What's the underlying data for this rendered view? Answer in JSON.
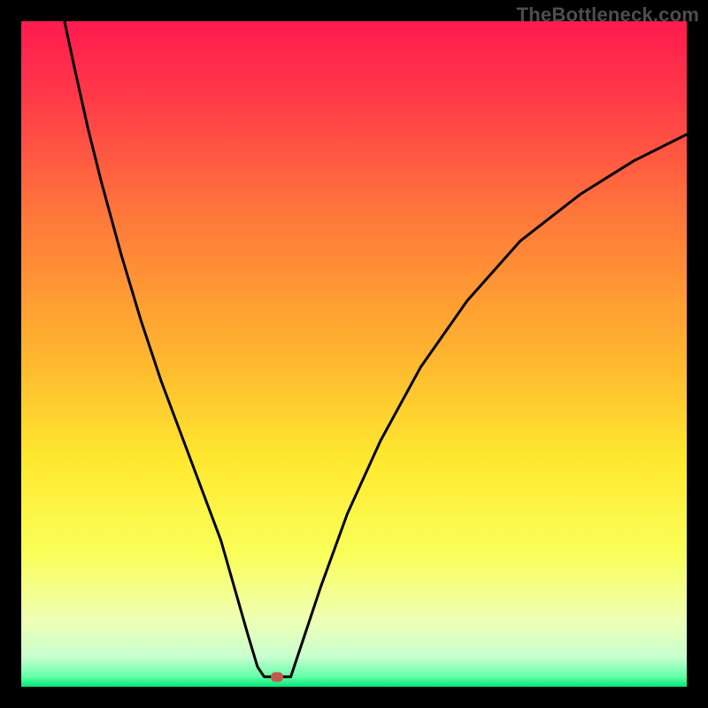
{
  "watermark": "TheBottleneck.com",
  "plot": {
    "inner_size": 752,
    "marker": {
      "x_frac": 0.384,
      "y_frac": 0.985,
      "color": "#c1594c"
    }
  },
  "chart_data": {
    "type": "line",
    "title": "",
    "xlabel": "",
    "ylabel": "",
    "xlim": [
      0,
      100
    ],
    "ylim": [
      0,
      100
    ],
    "gradient_stops": [
      {
        "offset": 0.0,
        "color": "#ff1a4f"
      },
      {
        "offset": 0.12,
        "color": "#ff3c48"
      },
      {
        "offset": 0.3,
        "color": "#ff7a3a"
      },
      {
        "offset": 0.5,
        "color": "#ffb42f"
      },
      {
        "offset": 0.66,
        "color": "#ffe92f"
      },
      {
        "offset": 0.8,
        "color": "#faff5a"
      },
      {
        "offset": 0.9,
        "color": "#eeffb4"
      },
      {
        "offset": 0.955,
        "color": "#c8ffcf"
      },
      {
        "offset": 0.985,
        "color": "#64ffa8"
      },
      {
        "offset": 1.0,
        "color": "#00e777"
      }
    ],
    "series": [
      {
        "name": "left_branch",
        "x": [
          6.5,
          8,
          10,
          12,
          15,
          18,
          21,
          24,
          27,
          30,
          32,
          34,
          35.5,
          36.5
        ],
        "y": [
          100,
          93,
          84,
          76,
          65,
          55,
          46,
          38,
          30,
          22,
          15,
          8,
          3,
          1.5
        ]
      },
      {
        "name": "valley_floor",
        "x": [
          36.5,
          40.5
        ],
        "y": [
          1.5,
          1.5
        ]
      },
      {
        "name": "right_branch",
        "x": [
          40.5,
          42,
          45,
          49,
          54,
          60,
          67,
          75,
          84,
          92,
          100
        ],
        "y": [
          1.5,
          6,
          15,
          26,
          37,
          48,
          58,
          67,
          74,
          79,
          83
        ]
      }
    ],
    "marker_point": {
      "x": 38.4,
      "y": 1.5
    }
  }
}
